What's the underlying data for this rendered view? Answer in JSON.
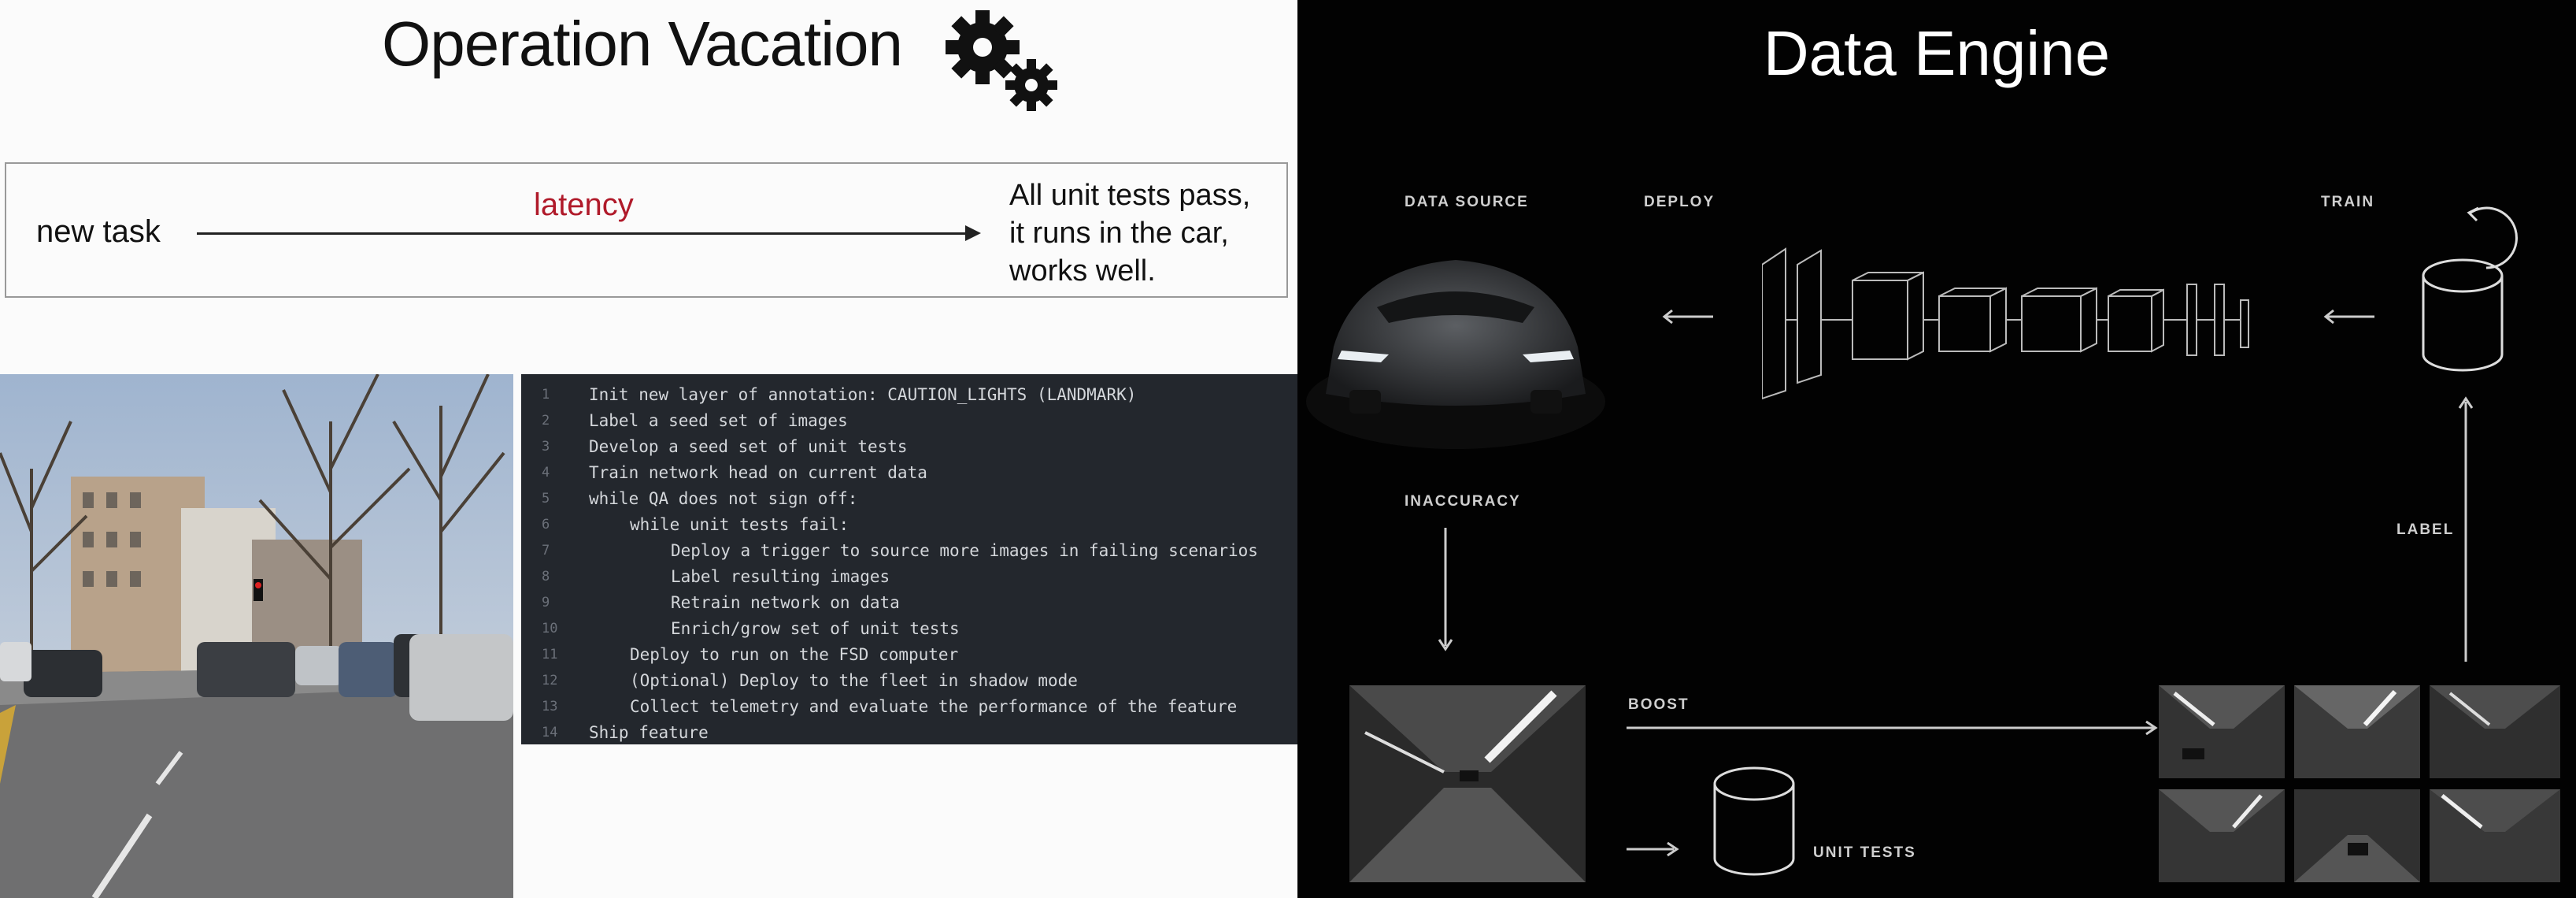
{
  "left": {
    "title": "Operation Vacation",
    "icon": "gears-icon",
    "flow": {
      "start": "new task",
      "middle": "latency",
      "end_lines": [
        "All unit tests pass,",
        "it runs in the car,",
        "works well."
      ],
      "middle_color": "#b01a2a"
    },
    "code_lines": [
      {
        "n": "1",
        "text": "Init new layer of annotation: CAUTION_LIGHTS (LANDMARK)",
        "indent": 0
      },
      {
        "n": "2",
        "text": "Label a seed set of images",
        "indent": 0
      },
      {
        "n": "3",
        "text": "Develop a seed set of unit tests",
        "indent": 0
      },
      {
        "n": "4",
        "text": "Train network head on current data",
        "indent": 0
      },
      {
        "n": "5",
        "text": "while QA does not sign off:",
        "indent": 0
      },
      {
        "n": "6",
        "text": "while unit tests fail:",
        "indent": 1
      },
      {
        "n": "7",
        "text": "Deploy a trigger to source more images in failing scenarios",
        "indent": 2
      },
      {
        "n": "8",
        "text": "Label resulting images",
        "indent": 2
      },
      {
        "n": "9",
        "text": "Retrain network on data",
        "indent": 2
      },
      {
        "n": "10",
        "text": "Enrich/grow set of unit tests",
        "indent": 2
      },
      {
        "n": "11",
        "text": "Deploy to run on the FSD computer",
        "indent": 1
      },
      {
        "n": "12",
        "text": "(Optional) Deploy to the fleet in shadow mode",
        "indent": 1
      },
      {
        "n": "13",
        "text": "Collect telemetry and evaluate the performance of the feature",
        "indent": 1
      },
      {
        "n": "14",
        "text": "Ship feature",
        "indent": 0
      }
    ]
  },
  "right": {
    "title": "Data Engine",
    "labels": {
      "data_source": "DATA SOURCE",
      "deploy": "DEPLOY",
      "train": "TRAIN",
      "inaccuracy": "INACCURACY",
      "label": "LABEL",
      "boost": "BOOST",
      "unit_tests": "UNIT TESTS"
    }
  }
}
